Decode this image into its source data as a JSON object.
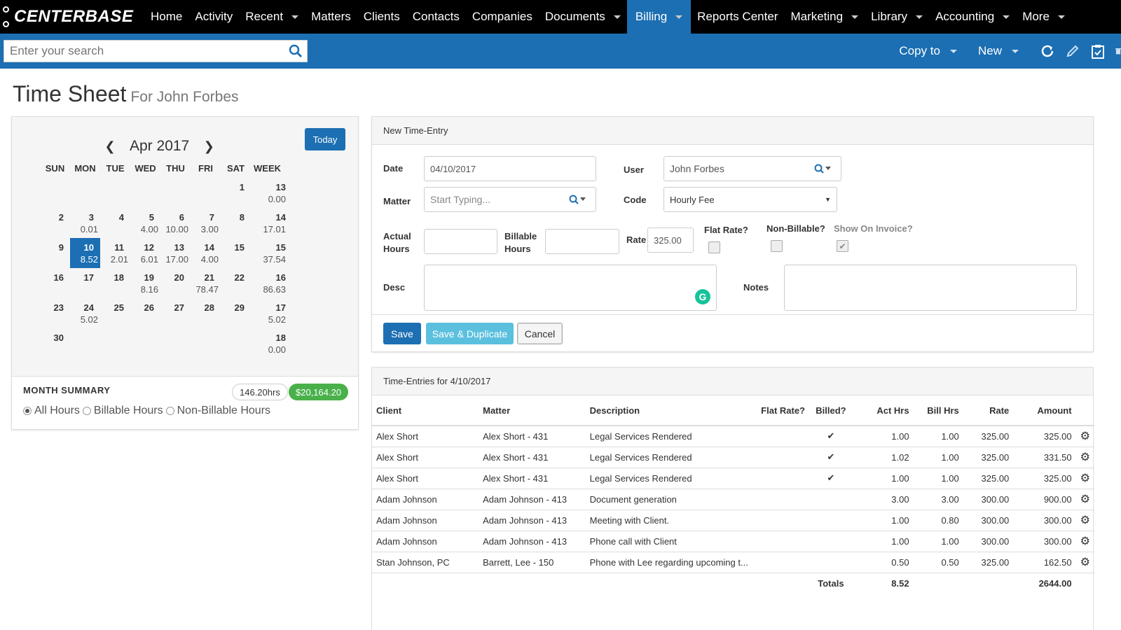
{
  "nav": {
    "logo": "CENTERBASE",
    "items": [
      {
        "label": "Home",
        "caret": false,
        "active": false
      },
      {
        "label": "Activity",
        "caret": false,
        "active": false
      },
      {
        "label": "Recent",
        "caret": true,
        "active": false
      },
      {
        "label": "Matters",
        "caret": false,
        "active": false
      },
      {
        "label": "Clients",
        "caret": false,
        "active": false
      },
      {
        "label": "Contacts",
        "caret": false,
        "active": false
      },
      {
        "label": "Companies",
        "caret": false,
        "active": false
      },
      {
        "label": "Documents",
        "caret": true,
        "active": false
      },
      {
        "label": "Billing",
        "caret": true,
        "active": true
      },
      {
        "label": "Reports Center",
        "caret": false,
        "active": false
      },
      {
        "label": "Marketing",
        "caret": true,
        "active": false
      },
      {
        "label": "Library",
        "caret": true,
        "active": false
      },
      {
        "label": "Accounting",
        "caret": true,
        "active": false
      },
      {
        "label": "More",
        "caret": true,
        "active": false
      }
    ]
  },
  "subbar": {
    "search_placeholder": "Enter your search",
    "copy_to": "Copy to",
    "new": "New"
  },
  "page": {
    "title": "Time Sheet",
    "subtitle": "For John Forbes"
  },
  "calendar": {
    "today_label": "Today",
    "month_label": "Apr 2017",
    "headers": [
      "SUN",
      "MON",
      "TUE",
      "WED",
      "THU",
      "FRI",
      "SAT",
      "WEEK"
    ],
    "weeks": [
      {
        "days": [
          [
            "",
            ""
          ],
          [
            "",
            ""
          ],
          [
            "",
            ""
          ],
          [
            "",
            ""
          ],
          [
            "",
            ""
          ],
          [
            "",
            ""
          ],
          [
            "1",
            ""
          ]
        ],
        "week": [
          "13",
          "0.00"
        ]
      },
      {
        "days": [
          [
            "2",
            ""
          ],
          [
            "3",
            "0.01"
          ],
          [
            "4",
            ""
          ],
          [
            "5",
            "4.00"
          ],
          [
            "6",
            "10.00"
          ],
          [
            "7",
            "3.00"
          ],
          [
            "8",
            ""
          ]
        ],
        "week": [
          "14",
          "17.01"
        ]
      },
      {
        "days": [
          [
            "9",
            ""
          ],
          [
            "10",
            "8.52"
          ],
          [
            "11",
            "2.01"
          ],
          [
            "12",
            "6.01"
          ],
          [
            "13",
            "17.00"
          ],
          [
            "14",
            "4.00"
          ],
          [
            "15",
            ""
          ]
        ],
        "week": [
          "15",
          "37.54"
        ]
      },
      {
        "days": [
          [
            "16",
            ""
          ],
          [
            "17",
            ""
          ],
          [
            "18",
            ""
          ],
          [
            "19",
            "8.16"
          ],
          [
            "20",
            ""
          ],
          [
            "21",
            "78.47"
          ],
          [
            "22",
            ""
          ]
        ],
        "week": [
          "16",
          "86.63"
        ]
      },
      {
        "days": [
          [
            "23",
            ""
          ],
          [
            "24",
            "5.02"
          ],
          [
            "25",
            ""
          ],
          [
            "26",
            ""
          ],
          [
            "27",
            ""
          ],
          [
            "28",
            ""
          ],
          [
            "29",
            ""
          ]
        ],
        "week": [
          "17",
          "5.02"
        ]
      },
      {
        "days": [
          [
            "30",
            ""
          ],
          [
            "",
            ""
          ],
          [
            "",
            ""
          ],
          [
            "",
            ""
          ],
          [
            "",
            ""
          ],
          [
            "",
            ""
          ],
          [
            "",
            ""
          ]
        ],
        "week": [
          "18",
          "0.00"
        ]
      }
    ],
    "selected_day": "10"
  },
  "summary": {
    "title": "MONTH SUMMARY",
    "hours": "146.20hrs",
    "amount": "$20,164.20",
    "radios": [
      "All Hours",
      "Billable Hours",
      "Non-Billable Hours"
    ],
    "selected": "All Hours"
  },
  "new_entry": {
    "title": "New Time-Entry",
    "date_label": "Date",
    "date_value": "04/10/2017",
    "user_label": "User",
    "user_value": "John Forbes",
    "matter_label": "Matter",
    "matter_placeholder": "Start Typing...",
    "code_label": "Code",
    "code_value": "Hourly Fee",
    "actual_hours_label_1": "Actual",
    "actual_hours_label_2": "Hours",
    "billable_hours_label_1": "Billable",
    "billable_hours_label_2": "Hours",
    "rate_label": "Rate",
    "rate_value": "325.00",
    "flat_rate_label": "Flat Rate?",
    "non_billable_label": "Non-Billable?",
    "show_on_invoice_label": "Show On Invoice?",
    "desc_label": "Desc",
    "notes_label": "Notes",
    "save": "Save",
    "save_dup": "Save & Duplicate",
    "cancel": "Cancel"
  },
  "entries": {
    "title": "Time-Entries for 4/10/2017",
    "columns": [
      "Client",
      "Matter",
      "Description",
      "Flat Rate?",
      "Billed?",
      "Act Hrs",
      "Bill Hrs",
      "Rate",
      "Amount"
    ],
    "rows": [
      {
        "client": "Alex Short",
        "matter": "Alex Short - 431",
        "desc": "Legal Services Rendered",
        "flat": "",
        "billed": "✔",
        "act": "1.00",
        "bill": "1.00",
        "rate": "325.00",
        "amount": "325.00"
      },
      {
        "client": "Alex Short",
        "matter": "Alex Short - 431",
        "desc": "Legal Services Rendered",
        "flat": "",
        "billed": "✔",
        "act": "1.02",
        "bill": "1.00",
        "rate": "325.00",
        "amount": "331.50"
      },
      {
        "client": "Alex Short",
        "matter": "Alex Short - 431",
        "desc": "Legal Services Rendered",
        "flat": "",
        "billed": "✔",
        "act": "1.00",
        "bill": "1.00",
        "rate": "325.00",
        "amount": "325.00"
      },
      {
        "client": "Adam Johnson",
        "matter": "Adam Johnson - 413",
        "desc": "Document generation",
        "flat": "",
        "billed": "",
        "act": "3.00",
        "bill": "3.00",
        "rate": "300.00",
        "amount": "900.00"
      },
      {
        "client": "Adam Johnson",
        "matter": "Adam Johnson - 413",
        "desc": "Meeting with Client.",
        "flat": "",
        "billed": "",
        "act": "1.00",
        "bill": "0.80",
        "rate": "300.00",
        "amount": "300.00"
      },
      {
        "client": "Adam Johnson",
        "matter": "Adam Johnson - 413",
        "desc": "Phone call with Client",
        "flat": "",
        "billed": "",
        "act": "1.00",
        "bill": "1.00",
        "rate": "300.00",
        "amount": "300.00"
      },
      {
        "client": "Stan Johnson, PC",
        "matter": "Barrett, Lee - 150",
        "desc": "Phone with Lee regarding upcoming t...",
        "flat": "",
        "billed": "",
        "act": "0.50",
        "bill": "0.50",
        "rate": "325.00",
        "amount": "162.50"
      }
    ],
    "totals_label": "Totals",
    "total_hours": "8.52",
    "total_amount": "2644.00"
  }
}
